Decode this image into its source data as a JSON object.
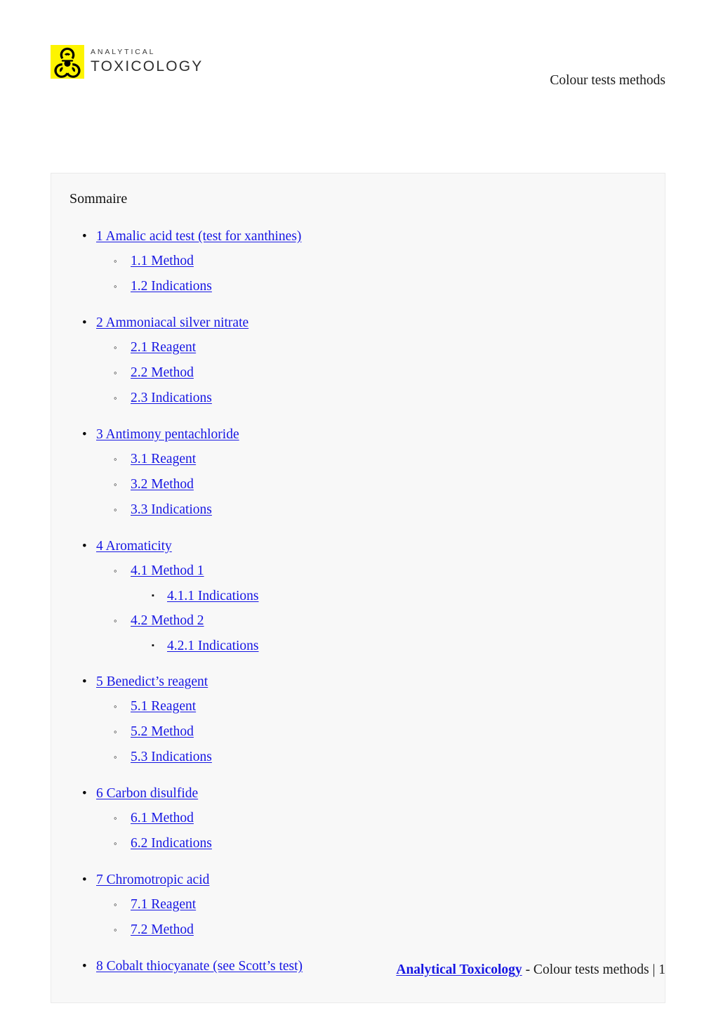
{
  "header": {
    "logo": {
      "icon": "biohazard-icon",
      "line1": "ANALYTICAL",
      "line2": "TOXICOLOGY",
      "badge_color": "#fdf400",
      "mark_color": "#000000"
    },
    "title": "Colour tests methods"
  },
  "toc": {
    "heading": "Sommaire",
    "link_color": "#1616e3",
    "box_background": "#f8f8f8",
    "items": [
      {
        "label": "1 Amalic acid test (test for xanthines)",
        "children": [
          {
            "label": "1.1 Method"
          },
          {
            "label": "1.2 Indications"
          }
        ]
      },
      {
        "label": "2 Ammoniacal silver nitrate",
        "children": [
          {
            "label": "2.1 Reagent"
          },
          {
            "label": "2.2 Method"
          },
          {
            "label": "2.3 Indications"
          }
        ]
      },
      {
        "label": "3 Antimony pentachloride",
        "children": [
          {
            "label": "3.1 Reagent"
          },
          {
            "label": "3.2 Method"
          },
          {
            "label": "3.3 Indications"
          }
        ]
      },
      {
        "label": "4 Aromaticity",
        "children": [
          {
            "label": "4.1 Method 1",
            "children": [
              {
                "label": "4.1.1 Indications"
              }
            ]
          },
          {
            "label": "4.2 Method 2",
            "children": [
              {
                "label": "4.2.1 Indications"
              }
            ]
          }
        ]
      },
      {
        "label": "5 Benedict’s reagent",
        "children": [
          {
            "label": "5.1 Reagent"
          },
          {
            "label": "5.2 Method"
          },
          {
            "label": "5.3 Indications"
          }
        ]
      },
      {
        "label": "6 Carbon disulfide",
        "children": [
          {
            "label": "6.1 Method"
          },
          {
            "label": "6.2 Indications"
          }
        ]
      },
      {
        "label": "7 Chromotropic acid",
        "children": [
          {
            "label": "7.1 Reagent"
          },
          {
            "label": "7.2 Method"
          }
        ]
      },
      {
        "label": "8 Cobalt thiocyanate (see Scott’s test)",
        "children": []
      }
    ],
    "bullets": {
      "level1": "•",
      "level2": "◦",
      "level3": "▪"
    }
  },
  "footer": {
    "link_label": "Analytical Toxicology",
    "rest": " - Colour tests methods | 1"
  }
}
